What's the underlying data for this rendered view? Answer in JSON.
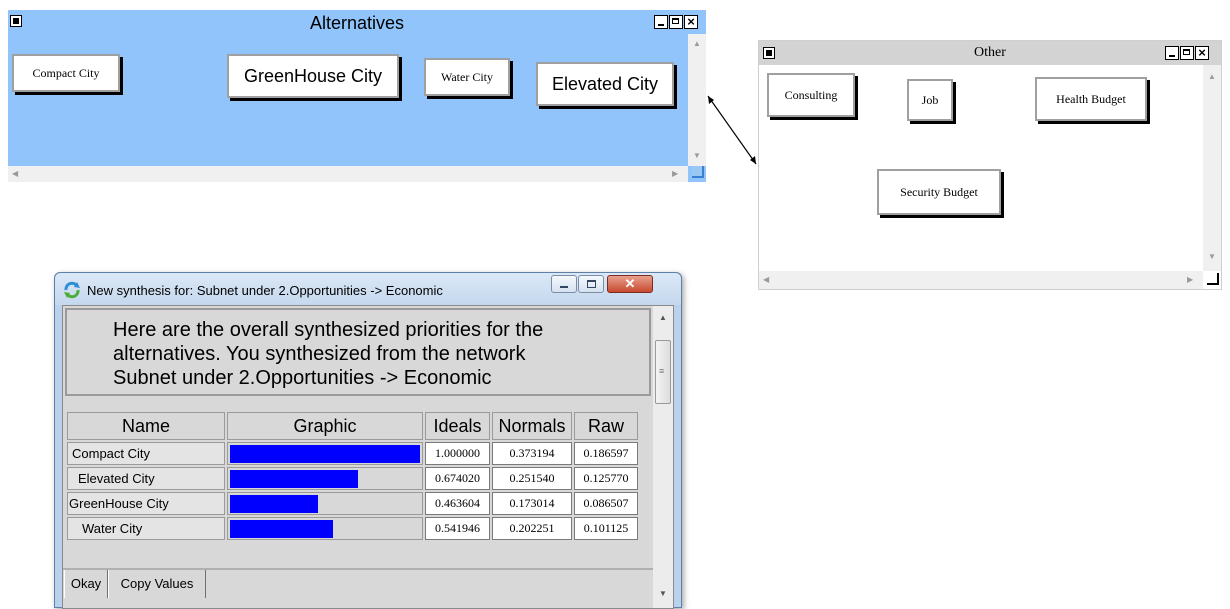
{
  "alternatives_window": {
    "title": "Alternatives",
    "nodes": [
      "Compact City",
      "GreenHouse City",
      "Water City",
      "Elevated City"
    ]
  },
  "other_window": {
    "title": "Other",
    "nodes": [
      "Consulting",
      "Job",
      "Health Budget",
      "Security Budget"
    ]
  },
  "synthesis_dialog": {
    "title": "New synthesis for: Subnet under 2.Opportunities -> Economic",
    "message_lines": [
      "Here are the overall synthesized priorities for the",
      "alternatives.  You synthesized from the network",
      "Subnet under 2.Opportunities -> Economic"
    ],
    "columns": [
      "Name",
      "Graphic",
      "Ideals",
      "Normals",
      "Raw"
    ],
    "rows": [
      {
        "name": "Compact City",
        "ideal": "1.000000",
        "normal": "0.373194",
        "raw": "0.186597",
        "bar_fraction": 1.0
      },
      {
        "name": "Elevated City",
        "ideal": "0.674020",
        "normal": "0.251540",
        "raw": "0.125770",
        "bar_fraction": 0.67402
      },
      {
        "name": "GreenHouse City",
        "ideal": "0.463604",
        "normal": "0.173014",
        "raw": "0.086507",
        "bar_fraction": 0.463604
      },
      {
        "name": "Water City",
        "ideal": "0.541946",
        "normal": "0.202251",
        "raw": "0.101125",
        "bar_fraction": 0.541946
      }
    ],
    "buttons": {
      "okay": "Okay",
      "copy": "Copy Values"
    },
    "bar_color": "#0000ff"
  }
}
